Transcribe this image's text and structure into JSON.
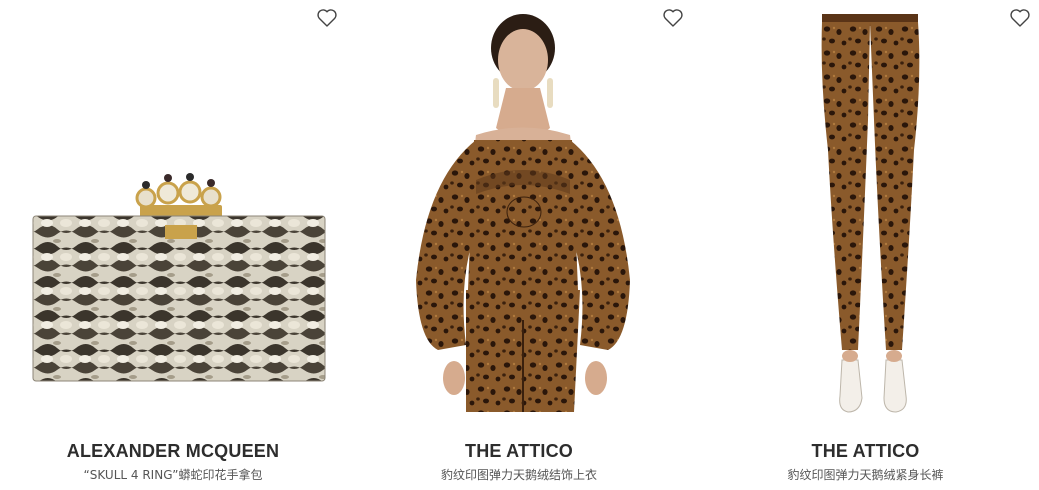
{
  "products": [
    {
      "brand": "ALEXANDER MCQUEEN",
      "description": "“SKULL 4 RING”蟒蛇印花手拿包",
      "image": "snakeskin-clutch-image",
      "wishlist_icon": "heart-outline-icon"
    },
    {
      "brand": "THE ATTICO",
      "description": "豹纹印图弹力天鹅绒结饰上衣",
      "image": "leopard-velvet-top-model-image",
      "wishlist_icon": "heart-outline-icon"
    },
    {
      "brand": "THE ATTICO",
      "description": "豹纹印图弹力天鹅绒紧身长裤",
      "image": "leopard-velvet-leggings-image",
      "wishlist_icon": "heart-outline-icon"
    }
  ],
  "colors": {
    "brand_text": "#2d2d2d",
    "description_text": "#555555",
    "icon_stroke": "#444444",
    "background": "#ffffff"
  }
}
